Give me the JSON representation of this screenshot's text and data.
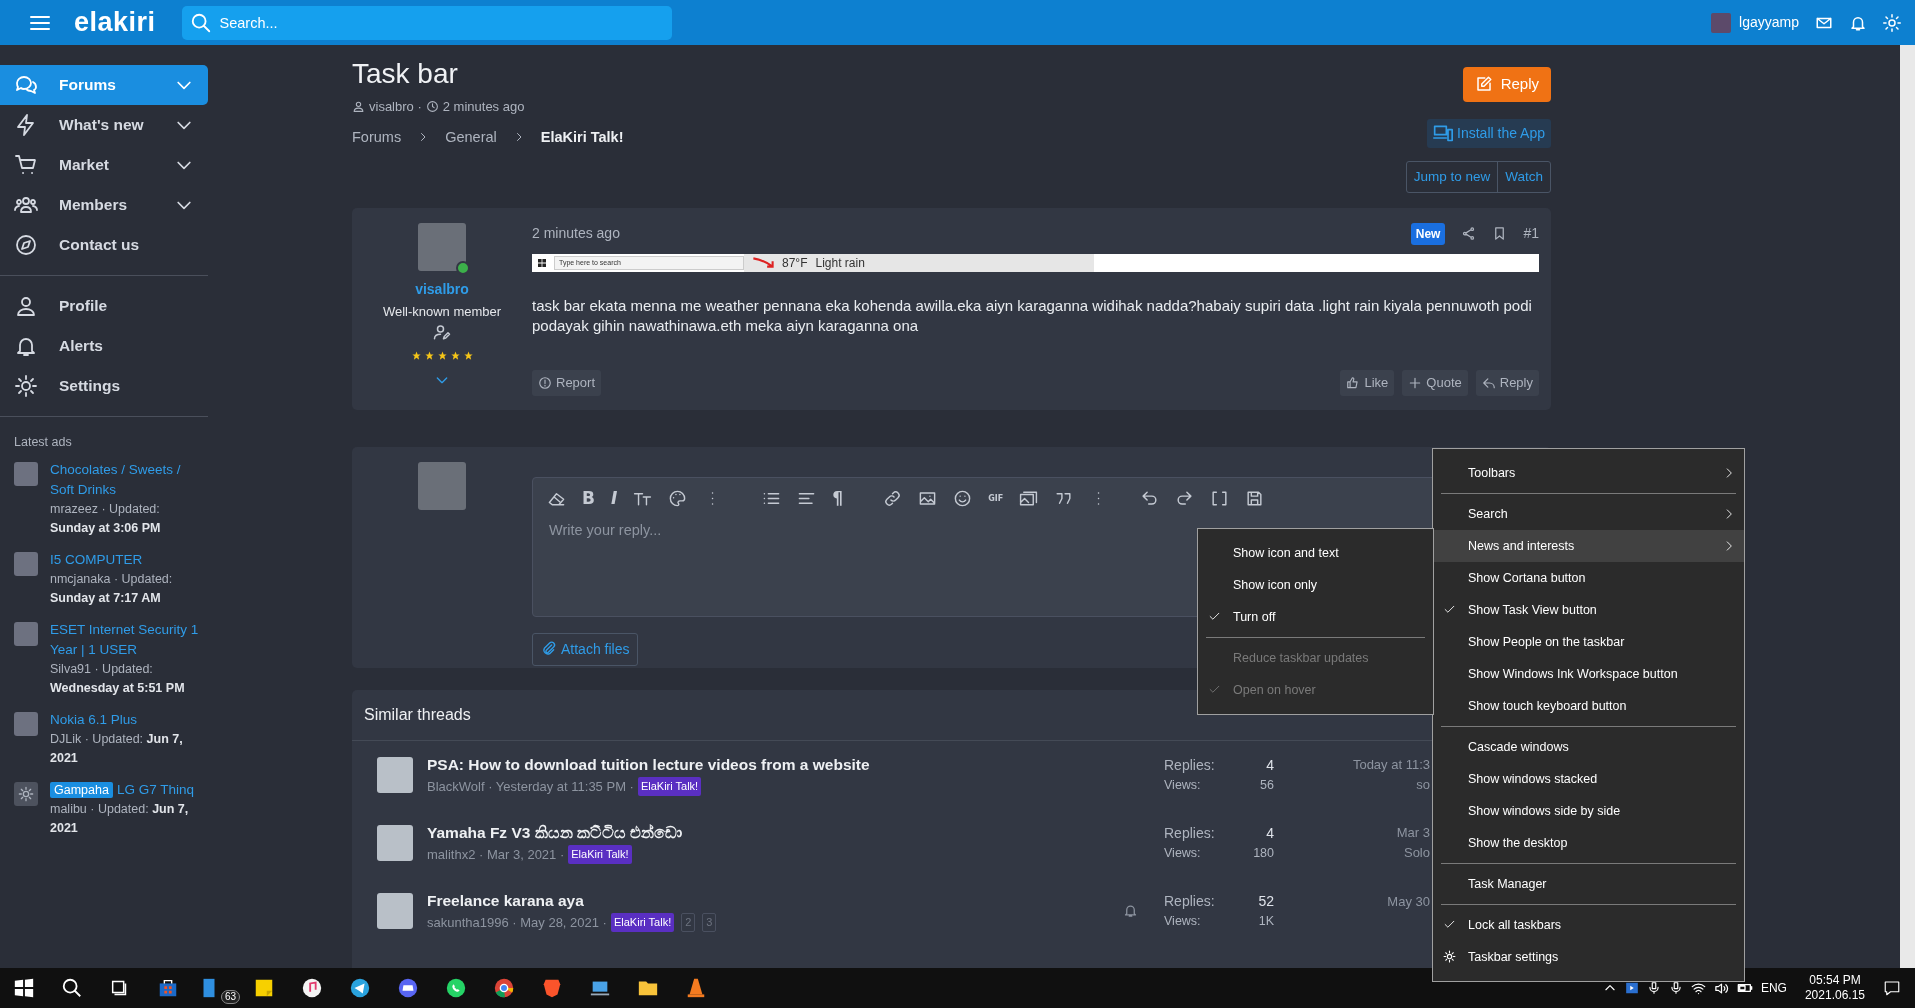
{
  "header": {
    "logo": "elakiri",
    "search_placeholder": "Search...",
    "username": "lgayyamp"
  },
  "sidebar": {
    "nav": [
      {
        "label": "Forums",
        "expandable": true,
        "selected": true
      },
      {
        "label": "What's new",
        "expandable": true,
        "selected": false
      },
      {
        "label": "Market",
        "expandable": true,
        "selected": false
      },
      {
        "label": "Members",
        "expandable": true,
        "selected": false
      },
      {
        "label": "Contact us",
        "expandable": false,
        "selected": false
      }
    ],
    "account": [
      {
        "label": "Profile"
      },
      {
        "label": "Alerts"
      },
      {
        "label": "Settings"
      }
    ],
    "ads_title": "Latest ads",
    "ads": [
      {
        "kind": "photo",
        "title": "Chocolates / Sweets / Soft Drinks",
        "meta": "mrazeez · Updated: **Sunday at 3:06 PM**"
      },
      {
        "kind": "photo",
        "title": "I5 COMPUTER",
        "meta": "nmcjanaka · Updated: **Sunday at 7:17 AM**"
      },
      {
        "kind": "photo",
        "title": "ESET Internet Security 1 Year | 1 USER",
        "meta": "Silva91 · Updated: **Wednesday at 5:51 PM**"
      },
      {
        "kind": "photo",
        "title": "Nokia 6.1 Plus",
        "meta": "DJLik · Updated: **Jun 7, 2021**"
      },
      {
        "kind": "placeholder",
        "tag": "Gampaha",
        "title": "LG G7 Thinq",
        "meta": "malibu · Updated: **Jun 7, 2021**"
      }
    ]
  },
  "thread": {
    "title": "Task bar",
    "author": "visalbro ·",
    "time": "2 minutes ago",
    "breadcrumbs": [
      {
        "label": "Forums",
        "current": false
      },
      {
        "label": "General",
        "current": false
      },
      {
        "label": "ElaKiri Talk!",
        "current": true
      }
    ],
    "reply_button": "Reply",
    "install_button": "Install the App",
    "jump_button": "Jump to new",
    "watch_button": "Watch"
  },
  "post": {
    "author": "visalbro",
    "online": true,
    "role": "Well-known member",
    "stars": 5,
    "time": "2 minutes ago",
    "badge": "New",
    "number": "#1",
    "attachment": {
      "search_placeholder": "Type here to search",
      "temperature": "87°F",
      "weather": "Light rain"
    },
    "text": "task bar ekata menna me weather pennana eka kohenda awilla.eka aiyn karaganna widihak nadda?habaiy supiri data .light rain kiyala pennuwoth podi podayak gihin nawathinawa.eth meka aiyn karaganna ona",
    "report": "Report",
    "actions": [
      "Like",
      "Quote",
      "Reply"
    ]
  },
  "editor": {
    "placeholder": "Write your reply...",
    "attach_button": "Attach files",
    "toolbar": [
      {
        "kind": "icon"
      },
      {
        "kind": "glyph",
        "text": "B",
        "italic": false
      },
      {
        "kind": "glyph",
        "text": "I",
        "italic": true
      },
      {
        "kind": "icon"
      },
      {
        "kind": "icon"
      },
      {
        "kind": "icon"
      },
      {
        "kind": "spacer"
      },
      {
        "kind": "icon"
      },
      {
        "kind": "icon"
      },
      {
        "kind": "glyph",
        "text": "¶",
        "italic": false
      },
      {
        "kind": "spacer"
      },
      {
        "kind": "icon"
      },
      {
        "kind": "icon"
      },
      {
        "kind": "icon"
      },
      {
        "kind": "glyph",
        "text": "GIF",
        "italic": false
      },
      {
        "kind": "icon"
      },
      {
        "kind": "icon"
      },
      {
        "kind": "icon"
      },
      {
        "kind": "push"
      },
      {
        "kind": "icon"
      },
      {
        "kind": "icon"
      },
      {
        "kind": "icon"
      },
      {
        "kind": "icon"
      }
    ]
  },
  "similar_threads": {
    "title": "Similar threads",
    "rows": [
      {
        "title": "PSA: How to download tuition lecture videos from a website",
        "byline": "BlackWolf · Yesterday at 11:35 PM ·",
        "tag": "ElaKiri Talk!",
        "watched": false,
        "replies_label": "Replies:",
        "replies": "4",
        "views_label": "Views:",
        "views": "56",
        "last_date": "Today at 11:3",
        "last_user": "so"
      },
      {
        "title": "Yamaha Fz V3 කියන කට්ටිය එන්ඩො",
        "byline": "malithx2 · Mar 3, 2021 ·",
        "tag": "ElaKiri Talk!",
        "watched": false,
        "replies_label": "Replies:",
        "replies": "4",
        "views_label": "Views:",
        "views": "180",
        "last_date": "Mar 3",
        "last_user": "Solo"
      },
      {
        "title": "Freelance karana aya",
        "byline": "sakuntha1996 · May 28, 2021 ·",
        "tag": "ElaKiri Talk!",
        "watched": true,
        "pages": [
          "2",
          "3"
        ],
        "replies_label": "Replies:",
        "replies": "52",
        "views_label": "Views:",
        "views": "1K",
        "last_date": "May 30"
      }
    ]
  },
  "submenu": {
    "items": [
      {
        "kind": "item",
        "label": "Show icon and text",
        "checked": false,
        "disabled": false
      },
      {
        "kind": "item",
        "label": "Show icon only",
        "checked": false,
        "disabled": false
      },
      {
        "kind": "item",
        "label": "Turn off",
        "checked": true,
        "disabled": false
      },
      {
        "kind": "separator"
      },
      {
        "kind": "item",
        "label": "Reduce taskbar updates",
        "checked": false,
        "disabled": true
      },
      {
        "kind": "item",
        "label": "Open on hover",
        "checked": true,
        "disabled": true
      }
    ]
  },
  "context_menu": {
    "items": [
      {
        "kind": "item",
        "label": "Toolbars",
        "submenu": true,
        "checked": false,
        "highlighted": false
      },
      {
        "kind": "separator"
      },
      {
        "kind": "item",
        "label": "Search",
        "submenu": true,
        "checked": false,
        "highlighted": false
      },
      {
        "kind": "item",
        "label": "News and interests",
        "submenu": true,
        "checked": false,
        "highlighted": true
      },
      {
        "kind": "item",
        "label": "Show Cortana button",
        "submenu": false,
        "checked": false,
        "highlighted": false
      },
      {
        "kind": "item",
        "label": "Show Task View button",
        "submenu": false,
        "checked": true,
        "highlighted": false
      },
      {
        "kind": "item",
        "label": "Show People on the taskbar",
        "submenu": false,
        "checked": false,
        "highlighted": false
      },
      {
        "kind": "item",
        "label": "Show Windows Ink Workspace button",
        "submenu": false,
        "checked": false,
        "highlighted": false
      },
      {
        "kind": "item",
        "label": "Show touch keyboard button",
        "submenu": false,
        "checked": false,
        "highlighted": false
      },
      {
        "kind": "separator"
      },
      {
        "kind": "item",
        "label": "Cascade windows",
        "submenu": false,
        "checked": false,
        "highlighted": false
      },
      {
        "kind": "item",
        "label": "Show windows stacked",
        "submenu": false,
        "checked": false,
        "highlighted": false
      },
      {
        "kind": "item",
        "label": "Show windows side by side",
        "submenu": false,
        "checked": false,
        "highlighted": false
      },
      {
        "kind": "item",
        "label": "Show the desktop",
        "submenu": false,
        "checked": false,
        "highlighted": false
      },
      {
        "kind": "separator"
      },
      {
        "kind": "item",
        "label": "Task Manager",
        "submenu": false,
        "checked": false,
        "highlighted": false
      },
      {
        "kind": "separator"
      },
      {
        "kind": "item",
        "label": "Lock all taskbars",
        "submenu": false,
        "checked": true,
        "highlighted": false
      },
      {
        "kind": "settings",
        "label": "Taskbar settings",
        "submenu": false,
        "checked": false,
        "highlighted": false
      }
    ]
  },
  "taskbar": {
    "badge": "63",
    "language": "ENG",
    "time": "05:54 PM",
    "date": "2021.06.15"
  }
}
